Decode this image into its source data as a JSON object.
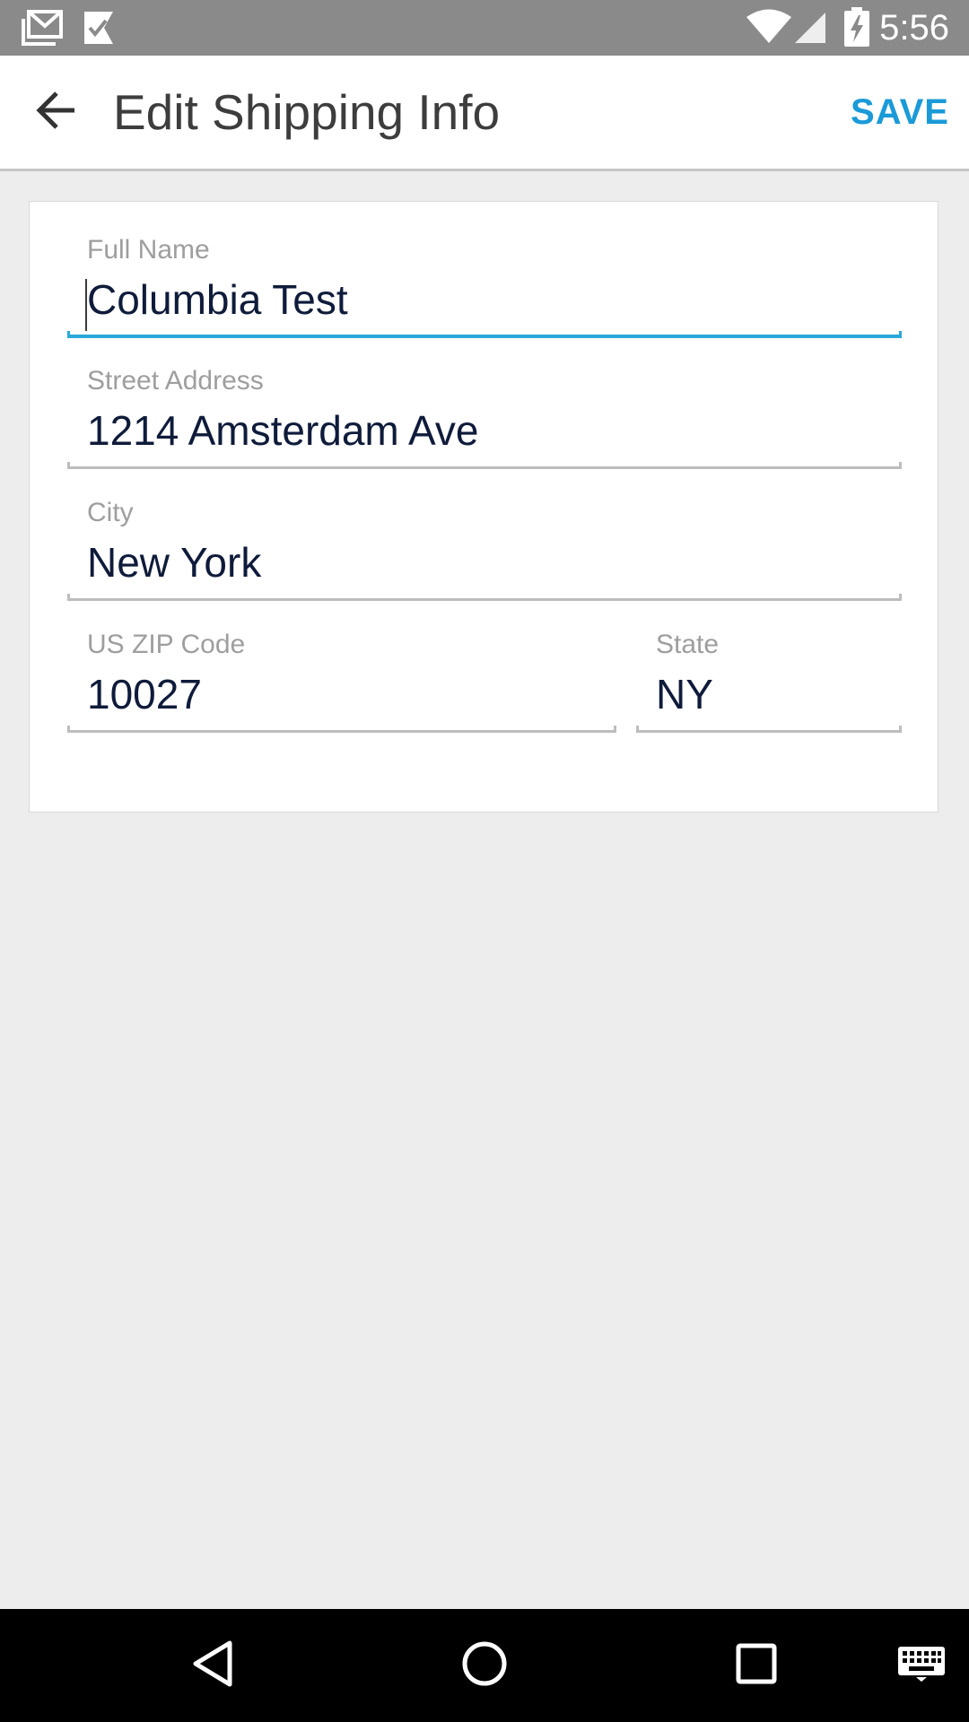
{
  "status_bar": {
    "time": "5:56",
    "icons": [
      "gmail-icon",
      "task-check-icon",
      "wifi-icon",
      "signal-icon",
      "battery-charging-icon"
    ]
  },
  "app_bar": {
    "back_icon": "arrow-back-icon",
    "title": "Edit Shipping Info",
    "save_label": "SAVE",
    "accent_color": "#1b9ad8"
  },
  "form": {
    "full_name": {
      "label": "Full Name",
      "value": "Columbia Test",
      "focused": true
    },
    "street_address": {
      "label": "Street Address",
      "value": "1214 Amsterdam Ave"
    },
    "city": {
      "label": "City",
      "value": "New York"
    },
    "zip": {
      "label": "US ZIP Code",
      "value": "10027"
    },
    "state": {
      "label": "State",
      "value": "NY"
    },
    "focus_color": "#2aa8d8"
  },
  "nav_bar": {
    "buttons": [
      "back-triangle-icon",
      "home-circle-icon",
      "recents-square-icon",
      "keyboard-icon"
    ]
  }
}
